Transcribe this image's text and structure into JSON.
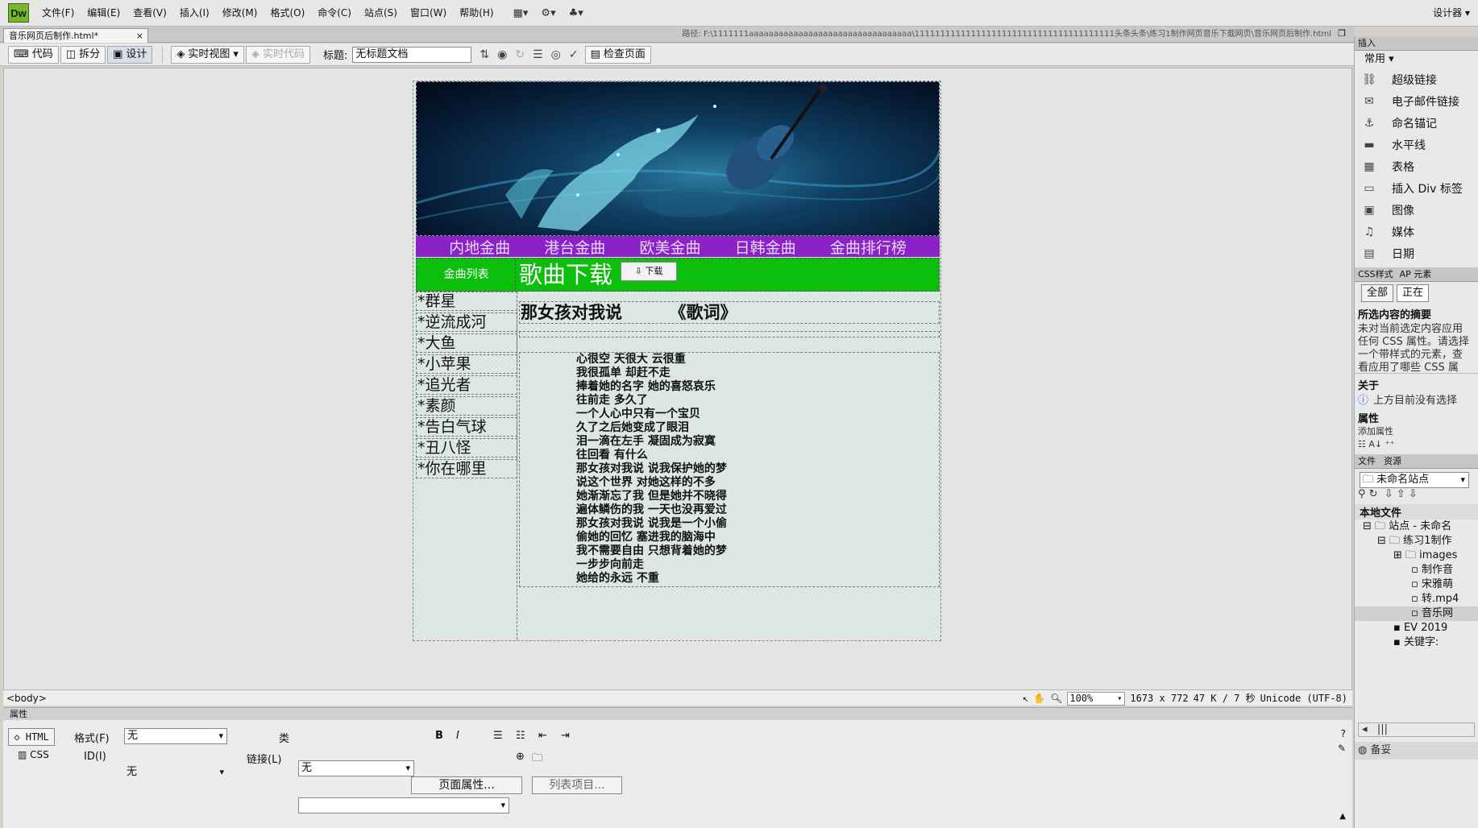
{
  "app": {
    "logo": "Dw",
    "designer_label": "设计器 ▾"
  },
  "menu": [
    "文件(F)",
    "编辑(E)",
    "查看(V)",
    "插入(I)",
    "修改(M)",
    "格式(O)",
    "命令(C)",
    "站点(S)",
    "窗口(W)",
    "帮助(H)"
  ],
  "document": {
    "tab_name": "音乐网页后制作.html*",
    "path": "路径: F:\\1111111aaaaaaaaaaaaaaaaaaaaaaaaaaaaaaaaa\\111111111111111111111111111111111111111头条头条\\练习1制作网页音乐下载网页\\音乐网页后制作.html"
  },
  "toolbar": {
    "code": "代码",
    "split": "拆分",
    "design": "设计",
    "live_view": "实时视图",
    "live_code": "实时代码",
    "title_label": "标题:",
    "title_value": "无标题文档",
    "check_page": "检查页面"
  },
  "webpage": {
    "nav": [
      "内地金曲",
      "港台金曲",
      "欧美金曲",
      "日韩金曲",
      "金曲排行榜"
    ],
    "list_title": "金曲列表",
    "download_title": "歌曲下载",
    "download_button": "下载",
    "songs": [
      "*群星",
      "*逆流成河",
      "*大鱼",
      "*小苹果",
      "*追光者",
      "*素颜",
      "*告白气球",
      "*丑八怪",
      "*你在哪里"
    ],
    "lyric_title": "那女孩对我说        《歌词》",
    "lyrics": [
      "心很空 天很大 云很重",
      "我很孤单 却赶不走",
      "捧着她的名字 她的喜怒哀乐",
      "往前走 多久了",
      "一个人心中只有一个宝贝",
      "久了之后她变成了眼泪",
      "泪一滴在左手 凝固成为寂寞",
      "往回看 有什么",
      "那女孩对我说 说我保护她的梦",
      "说这个世界 对她这样的不多",
      "她渐渐忘了我 但是她并不晓得",
      "遍体鳞伤的我 一天也没再爱过",
      "那女孩对我说 说我是一个小偷",
      "偷她的回忆 塞进我的脑海中",
      "我不需要自由 只想背着她的梦",
      "一步步向前走",
      "她给的永远 不重"
    ]
  },
  "status": {
    "tag": "<body>",
    "zoom": "100%",
    "dims": "1673 x 772",
    "size": "47 K / 7 秒",
    "encoding": "Unicode (UTF-8)"
  },
  "properties": {
    "header": "属性",
    "html_btn": "HTML",
    "css_btn": "CSS",
    "format_label": "格式(F)",
    "format_value": "无",
    "class_label": "类",
    "class_value": "无",
    "id_label": "ID(I)",
    "id_value": "无",
    "link_label": "链接(L)",
    "link_value": "",
    "page_props": "页面属性...",
    "list_item": "列表项目..."
  },
  "right_panel": {
    "insert_tab": "插入",
    "category": "常用",
    "items": [
      "超级链接",
      "电子邮件链接",
      "命名锚记",
      "水平线",
      "表格",
      "插入 Div 标签",
      "图像",
      "媒体",
      "日期"
    ],
    "css_tab": "CSS样式",
    "ap_tab": "AP 元素",
    "all_btn": "全部",
    "current_btn": "正在",
    "summary_title": "所选内容的摘要",
    "summary_text": "未对当前选定内容应用任何 CSS 属性。请选择一个带样式的元素，查看应用了哪些 CSS 属性。",
    "about_title": "关于",
    "about_text": "上方目前没有选择",
    "props_title": "属性",
    "add_prop": "添加属性",
    "files_tab": "文件",
    "assets_tab": "资源",
    "site_select": "未命名站点",
    "local_files": "本地文件",
    "tree": [
      "站点 - 未命名",
      "练习1制作",
      "images",
      "制作音",
      "宋雅萌",
      "转.mp4",
      "音乐网",
      "EV 2019",
      "关键字:"
    ],
    "footer": "备妥"
  }
}
